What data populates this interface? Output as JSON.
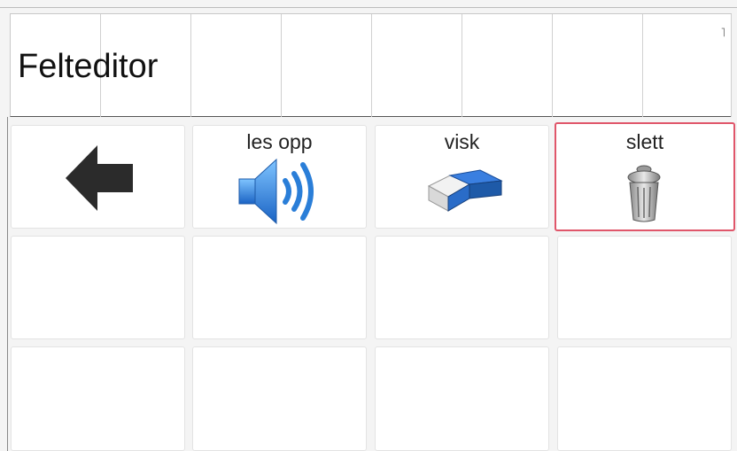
{
  "editor": {
    "text": "Felteditor",
    "corner_mark": "˥"
  },
  "grid": {
    "tiles": [
      {
        "label": "",
        "icon": "arrow-left-icon"
      },
      {
        "label": "les opp",
        "icon": "speaker-icon"
      },
      {
        "label": "visk",
        "icon": "eraser-icon"
      },
      {
        "label": "slett",
        "icon": "trash-icon",
        "selected": true
      }
    ]
  },
  "colors": {
    "selection_border": "#e0566a",
    "speaker_blue": "#2a7ed8",
    "eraser_blue": "#1e5aa8"
  }
}
